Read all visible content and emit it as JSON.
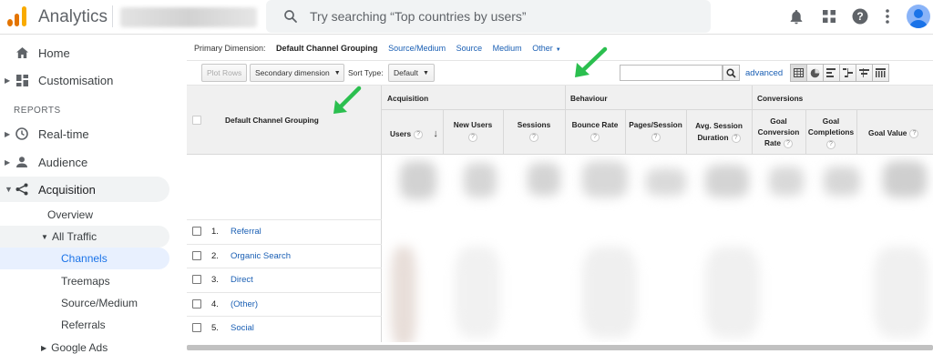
{
  "app": {
    "title": "Analytics",
    "search_placeholder": "Try searching “Top countries by users”",
    "brand_colors": [
      "#f9ab00",
      "#e37400"
    ]
  },
  "top_icons": [
    "bell-icon",
    "apps-grid-icon",
    "help-icon",
    "more-vert-icon",
    "account-avatar"
  ],
  "sidebar": {
    "home": "Home",
    "customisation": "Customisation",
    "reports_label": "REPORTS",
    "realtime": "Real-time",
    "audience": "Audience",
    "acquisition": "Acquisition",
    "overview": "Overview",
    "all_traffic": "All Traffic",
    "channels": "Channels",
    "treemaps": "Treemaps",
    "source_medium": "Source/Medium",
    "referrals": "Referrals",
    "google_ads": "Google Ads"
  },
  "primary_dimension": {
    "label": "Primary Dimension:",
    "active": "Default Channel Grouping",
    "options": [
      "Source/Medium",
      "Source",
      "Medium",
      "Other"
    ]
  },
  "toolbar": {
    "plot_rows": "Plot Rows",
    "secondary_dimension": "Secondary dimension",
    "sort_type_label": "Sort Type:",
    "sort_type_value": "Default",
    "advanced": "advanced"
  },
  "table": {
    "dimension_header": "Default Channel Grouping",
    "groups": {
      "acquisition": "Acquisition",
      "behaviour": "Behaviour",
      "conversions": "Conversions"
    },
    "columns": {
      "users": "Users",
      "new_users": "New Users",
      "sessions": "Sessions",
      "bounce_rate": "Bounce Rate",
      "pages_session": "Pages/Session",
      "avg_session_line1": "Avg. Session",
      "avg_session_line2": "Duration",
      "goal_conv_line1": "Goal",
      "goal_conv_line2": "Conversion",
      "goal_conv_line3": "Rate",
      "goal_comp_line1": "Goal",
      "goal_comp_line2": "Completions",
      "goal_value": "Goal Value"
    },
    "rows": [
      {
        "num": "1.",
        "label": "Referral"
      },
      {
        "num": "2.",
        "label": "Organic Search"
      },
      {
        "num": "3.",
        "label": "Direct"
      },
      {
        "num": "4.",
        "label": "(Other)"
      },
      {
        "num": "5.",
        "label": "Social"
      }
    ],
    "help_mark": "?"
  },
  "annotation_color": "#2bbf4f"
}
